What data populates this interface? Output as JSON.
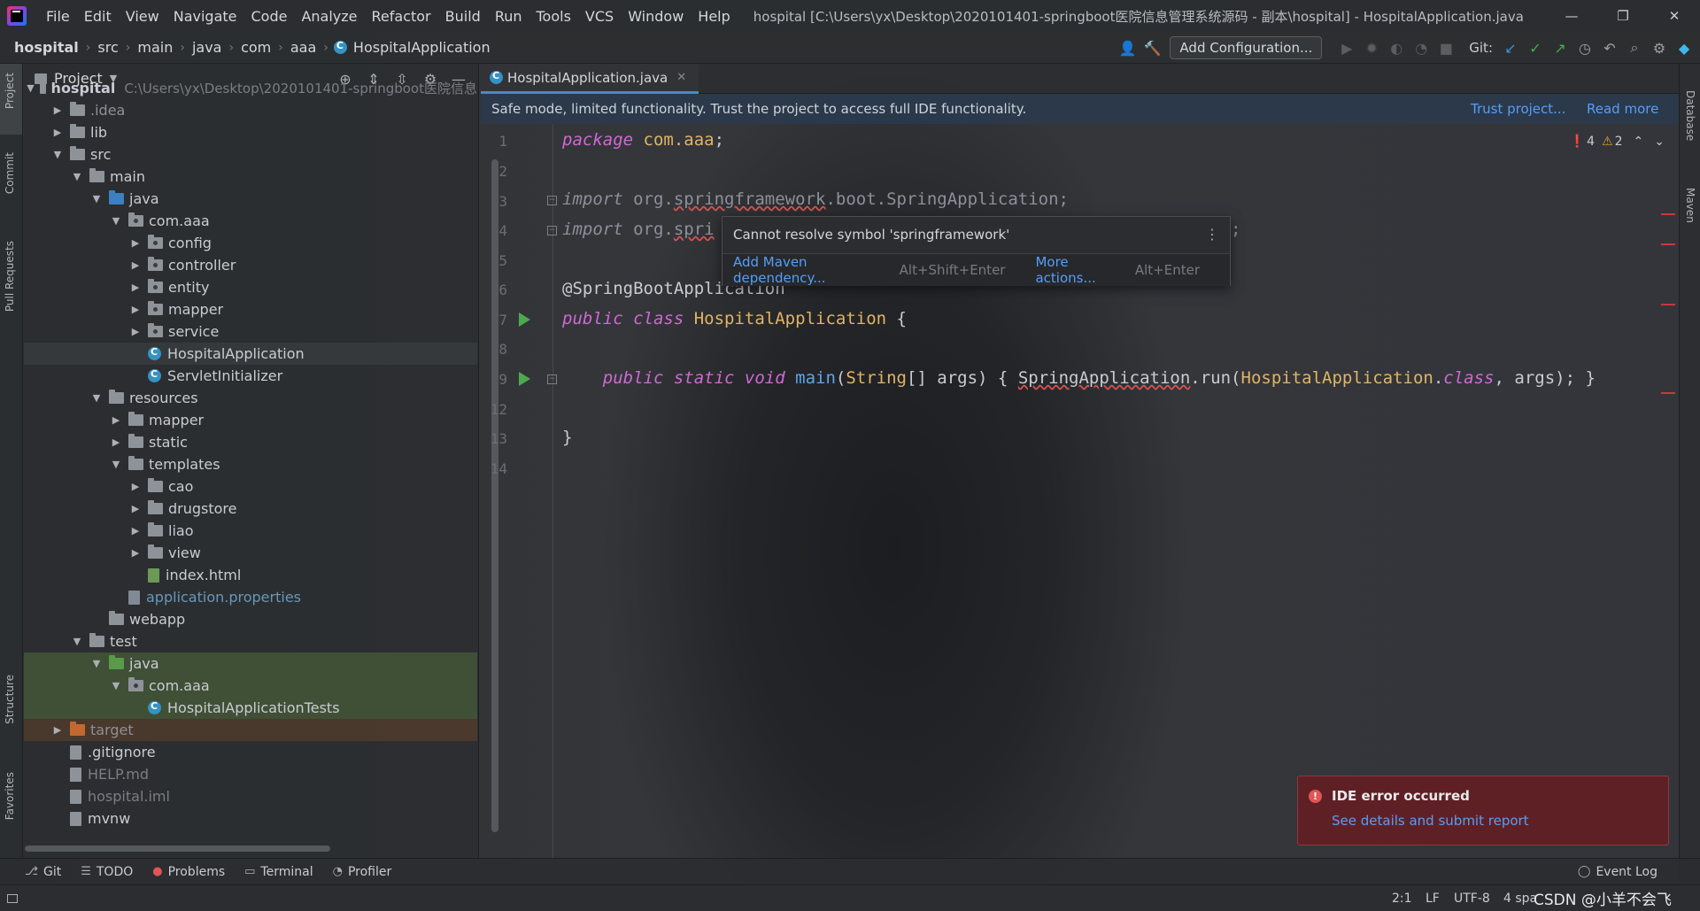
{
  "menu": [
    "File",
    "Edit",
    "View",
    "Navigate",
    "Code",
    "Analyze",
    "Refactor",
    "Build",
    "Run",
    "Tools",
    "VCS",
    "Window",
    "Help"
  ],
  "window_title": "hospital [C:\\Users\\yx\\Desktop\\2020101401-springboot医院信息管理系统源码 - 副本\\hospital] - HospitalApplication.java",
  "breadcrumb": [
    "hospital",
    "src",
    "main",
    "java",
    "com",
    "aaa",
    "HospitalApplication"
  ],
  "toolbar": {
    "add_configuration": "Add Configuration...",
    "git_label": "Git:"
  },
  "left_stripe": [
    "Project",
    "Commit",
    "Pull Requests",
    "Structure",
    "Favorites"
  ],
  "right_stripe": [
    "Database",
    "Maven"
  ],
  "project_panel": {
    "title": "Project",
    "root_path": "C:\\Users\\yx\\Desktop\\2020101401-springboot医院信息",
    "tree": [
      {
        "label": "hospital",
        "depth": 0,
        "arrow": "down",
        "icon": "folder"
      },
      {
        "label": ".idea",
        "depth": 1,
        "arrow": "right",
        "icon": "folder",
        "style": "muted"
      },
      {
        "label": "lib",
        "depth": 1,
        "arrow": "right",
        "icon": "folder"
      },
      {
        "label": "src",
        "depth": 1,
        "arrow": "down",
        "icon": "folder"
      },
      {
        "label": "main",
        "depth": 2,
        "arrow": "down",
        "icon": "folder"
      },
      {
        "label": "java",
        "depth": 3,
        "arrow": "down",
        "icon": "folder-blue"
      },
      {
        "label": "com.aaa",
        "depth": 4,
        "arrow": "down",
        "icon": "package"
      },
      {
        "label": "config",
        "depth": 5,
        "arrow": "right",
        "icon": "package"
      },
      {
        "label": "controller",
        "depth": 5,
        "arrow": "right",
        "icon": "package"
      },
      {
        "label": "entity",
        "depth": 5,
        "arrow": "right",
        "icon": "package"
      },
      {
        "label": "mapper",
        "depth": 5,
        "arrow": "right",
        "icon": "package"
      },
      {
        "label": "service",
        "depth": 5,
        "arrow": "right",
        "icon": "package"
      },
      {
        "label": "HospitalApplication",
        "depth": 5,
        "arrow": "",
        "icon": "class",
        "style": "selected"
      },
      {
        "label": "ServletInitializer",
        "depth": 5,
        "arrow": "",
        "icon": "class"
      },
      {
        "label": "resources",
        "depth": 3,
        "arrow": "down",
        "icon": "folder"
      },
      {
        "label": "mapper",
        "depth": 4,
        "arrow": "right",
        "icon": "folder"
      },
      {
        "label": "static",
        "depth": 4,
        "arrow": "right",
        "icon": "folder"
      },
      {
        "label": "templates",
        "depth": 4,
        "arrow": "down",
        "icon": "folder"
      },
      {
        "label": "cao",
        "depth": 5,
        "arrow": "right",
        "icon": "folder"
      },
      {
        "label": "drugstore",
        "depth": 5,
        "arrow": "right",
        "icon": "folder"
      },
      {
        "label": "liao",
        "depth": 5,
        "arrow": "right",
        "icon": "folder"
      },
      {
        "label": "view",
        "depth": 5,
        "arrow": "right",
        "icon": "folder"
      },
      {
        "label": "index.html",
        "depth": 5,
        "arrow": "",
        "icon": "html"
      },
      {
        "label": "application.properties",
        "depth": 4,
        "arrow": "",
        "icon": "properties",
        "style": "blue"
      },
      {
        "label": "webapp",
        "depth": 3,
        "arrow": "",
        "icon": "folder"
      },
      {
        "label": "test",
        "depth": 2,
        "arrow": "down",
        "icon": "folder"
      },
      {
        "label": "java",
        "depth": 3,
        "arrow": "down",
        "icon": "folder-green",
        "style": "test"
      },
      {
        "label": "com.aaa",
        "depth": 4,
        "arrow": "down",
        "icon": "package",
        "style": "test"
      },
      {
        "label": "HospitalApplicationTests",
        "depth": 5,
        "arrow": "",
        "icon": "class",
        "style": "test"
      },
      {
        "label": "target",
        "depth": 1,
        "arrow": "right",
        "icon": "folder-orange",
        "style": "excluded"
      },
      {
        "label": ".gitignore",
        "depth": 1,
        "arrow": "",
        "icon": "file"
      },
      {
        "label": "HELP.md",
        "depth": 1,
        "arrow": "",
        "icon": "file",
        "style": "dim"
      },
      {
        "label": "hospital.iml",
        "depth": 1,
        "arrow": "",
        "icon": "file",
        "style": "dim"
      },
      {
        "label": "mvnw",
        "depth": 1,
        "arrow": "",
        "icon": "file"
      }
    ]
  },
  "editor": {
    "tab": "HospitalApplication.java",
    "safe_mode": {
      "text": "Safe mode, limited functionality. Trust the project to access full IDE functionality.",
      "trust": "Trust project...",
      "read_more": "Read more"
    },
    "inspections": {
      "errors": "4",
      "warnings": "2"
    },
    "line_numbers": [
      "1",
      "2",
      "3",
      "4",
      "5",
      "6",
      "7",
      "8",
      "9",
      "12",
      "13",
      "14"
    ]
  },
  "popup": {
    "message": "Cannot resolve symbol 'springframework'",
    "action1": "Add Maven dependency...",
    "key1": "Alt+Shift+Enter",
    "action2": "More actions...",
    "key2": "Alt+Enter"
  },
  "notification": {
    "title": "IDE error occurred",
    "link": "See details and submit report"
  },
  "bottom_tools": [
    {
      "label": "Git",
      "icon": "git-icon"
    },
    {
      "label": "TODO",
      "icon": "list-icon"
    },
    {
      "label": "Problems",
      "icon": "error-icon"
    },
    {
      "label": "Terminal",
      "icon": "terminal-icon"
    },
    {
      "label": "Profiler",
      "icon": "profiler-icon"
    }
  ],
  "event_log": "Event Log",
  "status": {
    "position": "2:1",
    "line_sep": "LF",
    "encoding": "UTF-8",
    "indent": "4 spa",
    "watermark": "CSDN @小羊不会飞"
  }
}
